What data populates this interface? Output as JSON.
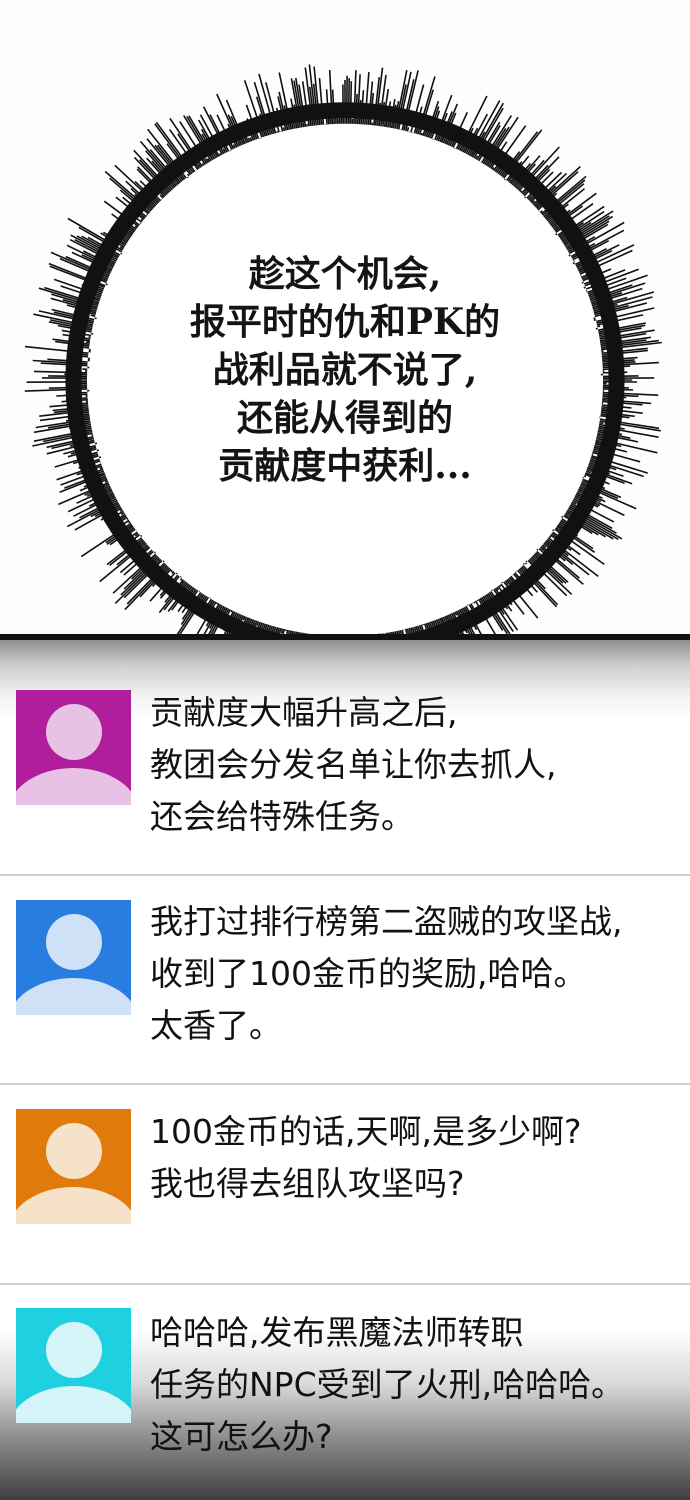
{
  "thought_bubble": {
    "lines": [
      "趁这个机会,",
      "报平时的仇和PK的",
      "战利品就不说了,",
      "还能从得到的",
      "贡献度中获利..."
    ]
  },
  "posts": [
    {
      "avatar_color": "#b01e9e",
      "avatar_figure": "#e8c2e4",
      "lines": [
        "贡献度大幅升高之后,",
        "教团会分发名单让你去抓人,",
        "还会给特殊任务。"
      ]
    },
    {
      "avatar_color": "#2a7de0",
      "avatar_figure": "#cfe1f7",
      "lines": [
        "我打过排行榜第二盗贼的攻坚战,",
        "收到了100金币的奖励,哈哈。",
        "太香了。"
      ]
    },
    {
      "avatar_color": "#e07a0a",
      "avatar_figure": "#f5e2c8",
      "lines": [
        "100金币的话,天啊,是多少啊?",
        "我也得去组队攻坚吗?"
      ]
    },
    {
      "avatar_color": "#1fd0e0",
      "avatar_figure": "#d6f5f8",
      "lines": [
        "哈哈哈,发布黑魔法师转职",
        "任务的NPC受到了火刑,哈哈哈。",
        "这可怎么办?"
      ]
    }
  ]
}
